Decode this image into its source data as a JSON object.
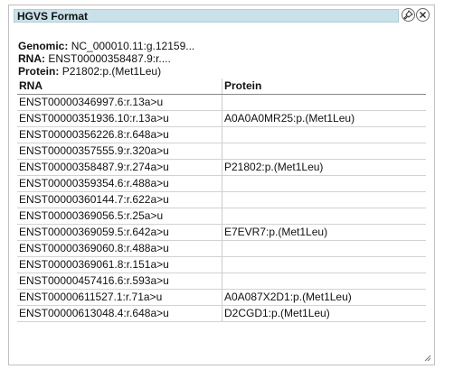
{
  "dialog": {
    "title": "HGVS Format",
    "pin_icon": "pin-icon",
    "close_icon": "close-icon"
  },
  "summary": {
    "genomic_label": "Genomic:",
    "genomic_value": "NC_000010.11:g.12159...",
    "rna_label": "RNA:",
    "rna_value": "ENST00000358487.9:r....",
    "protein_label": "Protein:",
    "protein_value": "P21802:p.(Met1Leu)"
  },
  "table": {
    "headers": {
      "rna": "RNA",
      "protein": "Protein"
    },
    "rows": [
      {
        "rna": "ENST00000346997.6:r.13a>u",
        "protein": ""
      },
      {
        "rna": "ENST00000351936.10:r.13a>u",
        "protein": "A0A0A0MR25:p.(Met1Leu)"
      },
      {
        "rna": "ENST00000356226.8:r.648a>u",
        "protein": ""
      },
      {
        "rna": "ENST00000357555.9:r.320a>u",
        "protein": ""
      },
      {
        "rna": "ENST00000358487.9:r.274a>u",
        "protein": "P21802:p.(Met1Leu)"
      },
      {
        "rna": "ENST00000359354.6:r.488a>u",
        "protein": ""
      },
      {
        "rna": "ENST00000360144.7:r.622a>u",
        "protein": ""
      },
      {
        "rna": "ENST00000369056.5:r.25a>u",
        "protein": ""
      },
      {
        "rna": "ENST00000369059.5:r.642a>u",
        "protein": "E7EVR7:p.(Met1Leu)"
      },
      {
        "rna": "ENST00000369060.8:r.488a>u",
        "protein": ""
      },
      {
        "rna": "ENST00000369061.8:r.151a>u",
        "protein": ""
      },
      {
        "rna": "ENST00000457416.6:r.593a>u",
        "protein": ""
      },
      {
        "rna": "ENST00000611527.1:r.71a>u",
        "protein": "A0A087X2D1:p.(Met1Leu)"
      },
      {
        "rna": "ENST00000613048.4:r.648a>u",
        "protein": "D2CGD1:p.(Met1Leu)"
      }
    ]
  },
  "colors": {
    "titlebar": "#c9e2ea",
    "border": "#bfbfbf"
  }
}
